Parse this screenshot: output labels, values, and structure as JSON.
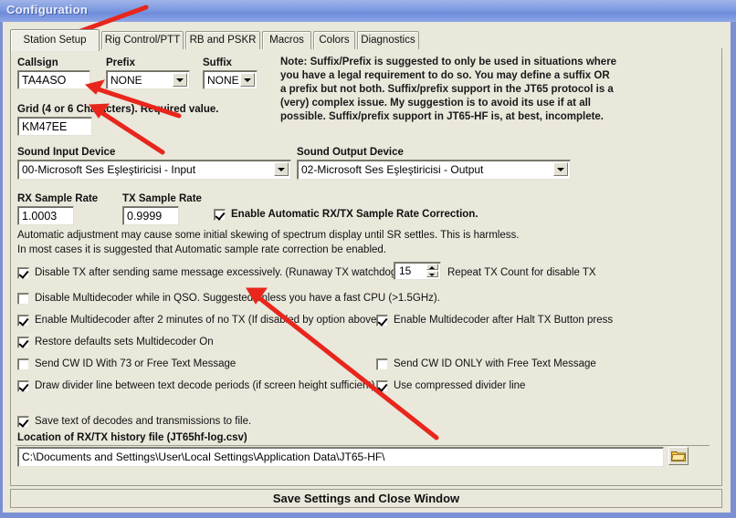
{
  "window": {
    "title": "Configuration",
    "titlebar_color": "#7d99e0",
    "client_bg": "#eae7db"
  },
  "tabs": [
    {
      "label": "Station Setup",
      "active": true
    },
    {
      "label": "Rig Control/PTT",
      "active": false
    },
    {
      "label": "RB and PSKR",
      "active": false
    },
    {
      "label": "Macros",
      "active": false
    },
    {
      "label": "Colors",
      "active": false
    },
    {
      "label": "Diagnostics",
      "active": false
    }
  ],
  "station": {
    "callsign_label": "Callsign",
    "callsign_value": "TA4ASO",
    "prefix_label": "Prefix",
    "prefix_value": "NONE",
    "suffix_label": "Suffix",
    "suffix_value": "NONE",
    "grid_label": "Grid (4 or 6 Characters).  Required value.",
    "grid_value": "KM47EE"
  },
  "note_lines": [
    "Note:  Suffix/Prefix is suggested to only be used in situations where",
    "you have a legal requirement to do so.  You may define a suffix OR",
    "a prefix but not both.  Suffix/prefix support in the JT65 protocol is a",
    "(very) complex issue.  My suggestion is to avoid its use if at all",
    "possible.  Suffix/prefix support in JT65-HF is, at best, incomplete."
  ],
  "sound": {
    "input_label": "Sound Input Device",
    "input_value": "00-Microsoft Ses Eşleştiricisi - Input",
    "output_label": "Sound Output Device",
    "output_value": "02-Microsoft Ses Eşleştiricisi - Output"
  },
  "sample_rate": {
    "rx_label": "RX Sample Rate",
    "rx_value": "1.0003",
    "tx_label": "TX Sample Rate",
    "tx_value": "0.9999",
    "auto_correction_label": "Enable Automatic RX/TX Sample Rate Correction.",
    "auto_correction_checked": true,
    "info_line1": "Automatic adjustment may cause some initial skewing of spectrum display until SR settles.  This is harmless.",
    "info_line2": "In most cases it is suggested that Automatic sample rate correction be enabled."
  },
  "options": {
    "runaway_tx_label": "Disable TX after sending same message excessively. (Runaway TX watchdog)",
    "runaway_tx_checked": true,
    "repeat_count_value": "15",
    "repeat_count_label": "Repeat TX Count for disable TX",
    "disable_multidecoder_qso_label": "Disable Multidecoder while in QSO.  Suggested unless you have a fast CPU (>1.5GHz).",
    "disable_multidecoder_qso_checked": false,
    "enable_multidecoder_2min_label": "Enable Multidecoder after 2 minutes of no TX (If disabled by option above).",
    "enable_multidecoder_2min_checked": true,
    "enable_multidecoder_halt_label": "Enable Multidecoder after Halt TX Button press",
    "enable_multidecoder_halt_checked": true,
    "restore_defaults_label": "Restore defaults sets Multidecoder On",
    "restore_defaults_checked": true,
    "send_cwid_73_label": "Send CW ID With 73 or Free Text Message",
    "send_cwid_73_checked": false,
    "send_cwid_only_label": "Send CW ID ONLY with Free Text Message",
    "send_cwid_only_checked": false,
    "draw_divider_label": "Draw divider line between text decode periods (if screen height sufficient)",
    "draw_divider_checked": true,
    "compressed_divider_label": "Use compressed divider line",
    "compressed_divider_checked": true,
    "save_text_label": "Save text of decodes and transmissions to file.",
    "save_text_checked": true
  },
  "history_file": {
    "label": "Location of RX/TX history file (JT65hf-log.csv)",
    "path": "C:\\Documents and Settings\\User\\Local Settings\\Application Data\\JT65-HF\\",
    "browse_icon": "folder-icon"
  },
  "footer": {
    "save_label": "Save Settings and Close Window"
  },
  "annotations": {
    "arrow_color": "#e8261c",
    "count": 4
  }
}
